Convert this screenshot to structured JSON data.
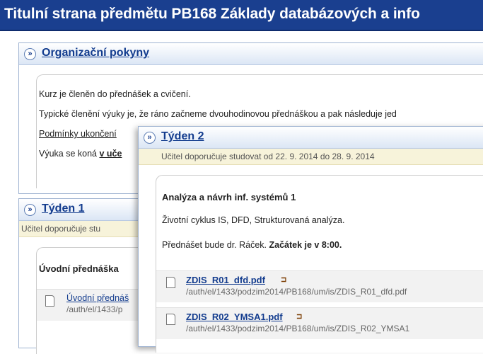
{
  "page": {
    "title": "Titulní strana předmětu PB168 Základy databázových a info"
  },
  "organizacni": {
    "heading": "Organizační pokyny",
    "line1": "Kurz je členěn do přednášek a cvičení.",
    "line2": "Typické členění výuky je, že ráno začneme dvouhodinovou přednáškou a pak následuje jed",
    "line3": "Podmínky ukončení",
    "line4_prefix": "Výuka se koná ",
    "line4_link": "v uče"
  },
  "tyden1": {
    "heading": "Týden 1",
    "hint": "Učitel doporučuje stu",
    "lecture_title": "Úvodní přednáška",
    "file_name": "Úvodní přednáš",
    "file_path": "/auth/el/1433/p"
  },
  "tyden2": {
    "heading": "Týden 2",
    "hint": "Učitel doporučuje studovat od 22. 9. 2014 do 28. 9. 2014",
    "lecture_title": "Analýza a návrh inf. systémů 1",
    "lecture_desc": "Životní cyklus IS, DFD, Strukturovaná analýza.",
    "lecturer_text": "Přednášet bude dr. Ráček. ",
    "start_text": "Začátek je v 8:00.",
    "files": [
      {
        "name": "ZDIS_R01_dfd.pdf",
        "path": "/auth/el/1433/podzim2014/PB168/um/is/ZDIS_R01_dfd.pdf"
      },
      {
        "name": "ZDIS_R02_YMSA1.pdf",
        "path": "/auth/el/1433/podzim2014/PB168/um/is/ZDIS_R02_YMSA1"
      }
    ]
  },
  "icons": {
    "raquo": "»",
    "rss": "⊐"
  }
}
